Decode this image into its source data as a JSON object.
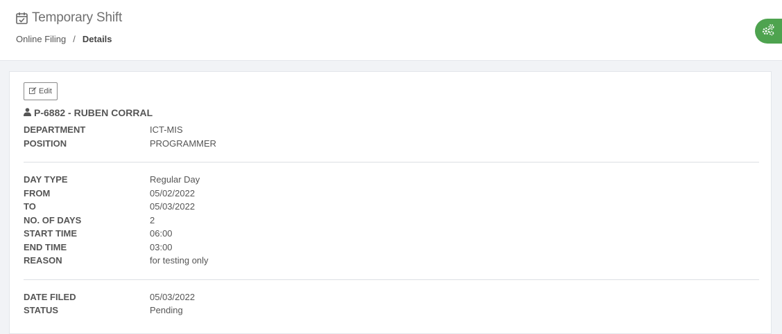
{
  "header": {
    "title": "Temporary Shift",
    "breadcrumb": {
      "parent": "Online Filing",
      "separator": "/",
      "current": "Details"
    }
  },
  "actions": {
    "edit_label": "Edit"
  },
  "employee": {
    "label": "P-6882 - RUBEN CORRAL"
  },
  "info": {
    "department_label": "DEPARTMENT",
    "department_value": "ICT-MIS",
    "position_label": "POSITION",
    "position_value": "PROGRAMMER"
  },
  "shift": {
    "day_type_label": "DAY TYPE",
    "day_type_value": "Regular Day",
    "from_label": "FROM",
    "from_value": "05/02/2022",
    "to_label": "TO",
    "to_value": "05/03/2022",
    "days_label": "NO. OF DAYS",
    "days_value": "2",
    "start_label": "START TIME",
    "start_value": "06:00",
    "end_label": "END TIME",
    "end_value": "03:00",
    "reason_label": "REASON",
    "reason_value": "for testing only"
  },
  "filing": {
    "date_label": "DATE FILED",
    "date_value": "05/03/2022",
    "status_label": "STATUS",
    "status_value": "Pending"
  },
  "colors": {
    "accent_green": "#4ea34f",
    "text": "#555555",
    "background": "#f1f3f6"
  }
}
